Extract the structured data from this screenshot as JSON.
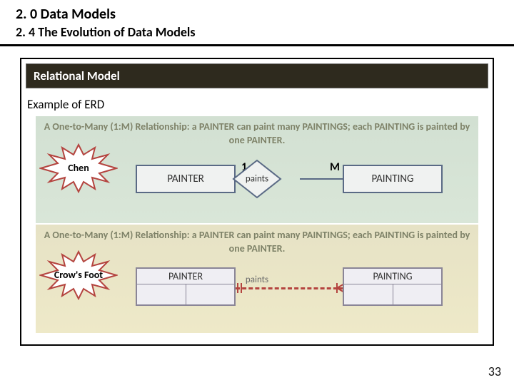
{
  "header": {
    "title": "2. 0 Data Models",
    "subtitle": "2. 4 The Evolution of Data Models"
  },
  "section": {
    "heading": "Relational Model",
    "example_label": "Example of  ERD"
  },
  "erd": {
    "description": "A One-to-Many (1:M) Relationship: a PAINTER can paint many PAINTINGS; each PAINTING is painted by one PAINTER.",
    "entity_left": "PAINTER",
    "entity_right": "PAINTING",
    "relation": "paints",
    "card_left": "1",
    "card_right": "M",
    "burst_chen": "Chen",
    "burst_crow": "Crow's Foot"
  },
  "page_number": "33"
}
